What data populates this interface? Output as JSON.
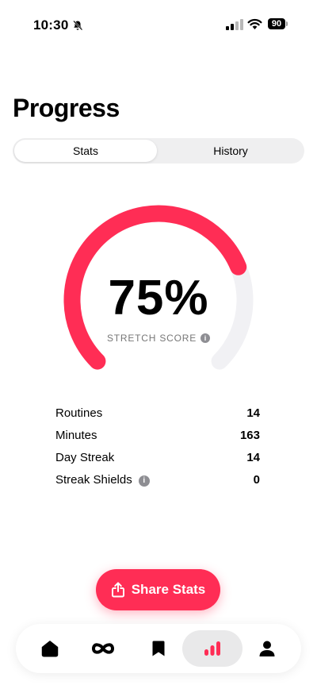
{
  "status_bar": {
    "time": "10:30",
    "battery": "90"
  },
  "page": {
    "title": "Progress"
  },
  "tabs": [
    {
      "label": "Stats",
      "selected": true
    },
    {
      "label": "History",
      "selected": false
    }
  ],
  "score": {
    "value": "75%",
    "fraction": 0.75,
    "label": "STRETCH SCORE"
  },
  "stats": [
    {
      "label": "Routines",
      "value": "14"
    },
    {
      "label": "Minutes",
      "value": "163"
    },
    {
      "label": "Day Streak",
      "value": "14"
    },
    {
      "label": "Streak Shields",
      "value": "0",
      "has_info": true
    }
  ],
  "share": {
    "label": "Share Stats"
  },
  "tabbar": {
    "items": [
      "home-icon",
      "infinity-icon",
      "bookmark-icon",
      "stats-icon",
      "profile-icon"
    ],
    "active": "stats-icon"
  },
  "colors": {
    "accent": "#ff2d55",
    "track": "#f1f1f4"
  }
}
